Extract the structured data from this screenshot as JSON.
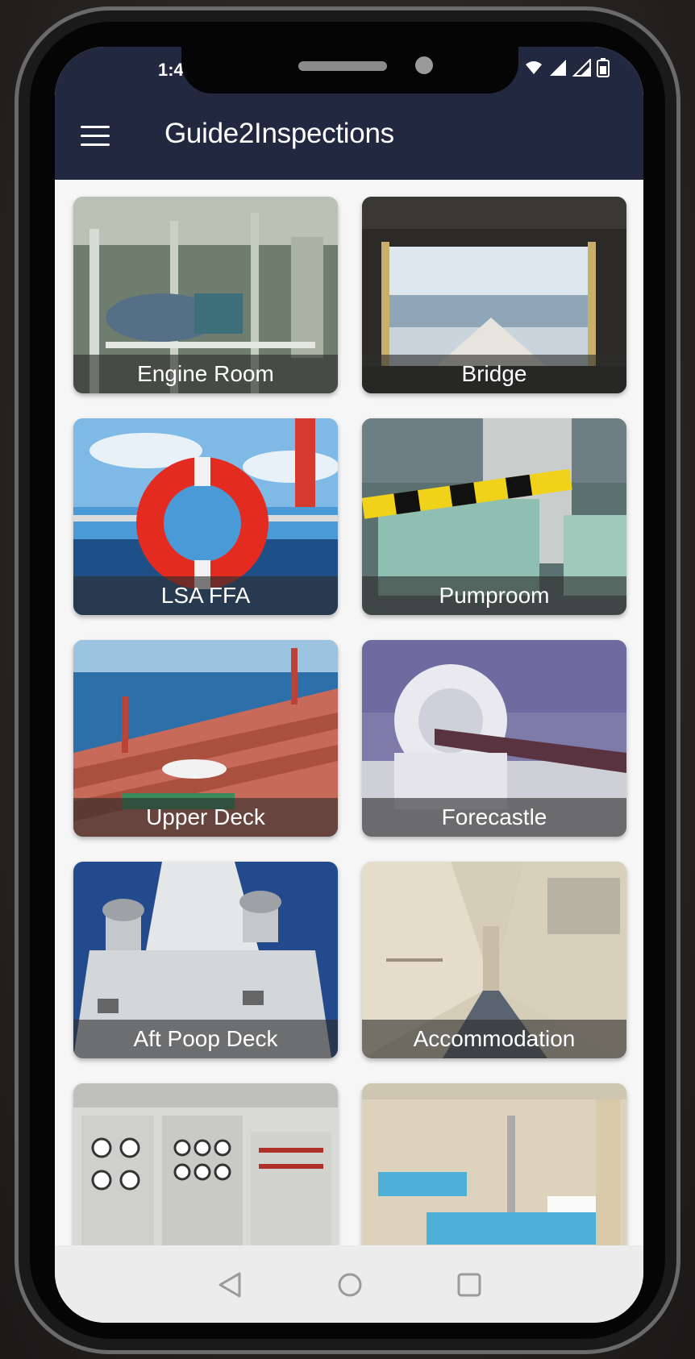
{
  "status_bar": {
    "time": "1:4"
  },
  "app_bar": {
    "title": "Guide2Inspections",
    "menu_icon": "hamburger-menu-icon"
  },
  "categories": [
    {
      "label": "Engine Room"
    },
    {
      "label": "Bridge"
    },
    {
      "label": "LSA FFA"
    },
    {
      "label": "Pumproom"
    },
    {
      "label": "Upper Deck"
    },
    {
      "label": "Forecastle"
    },
    {
      "label": "Aft Poop Deck"
    },
    {
      "label": "Accommodation"
    },
    {
      "label": ""
    },
    {
      "label": ""
    }
  ],
  "nav_bar": {
    "back_icon": "back-triangle-icon",
    "home_icon": "home-circle-icon",
    "recents_icon": "recents-square-icon"
  },
  "colors": {
    "app_bar": "#22283f",
    "caption_bg": "#2d2d2d",
    "screen_bg": "#f6f6f6"
  }
}
